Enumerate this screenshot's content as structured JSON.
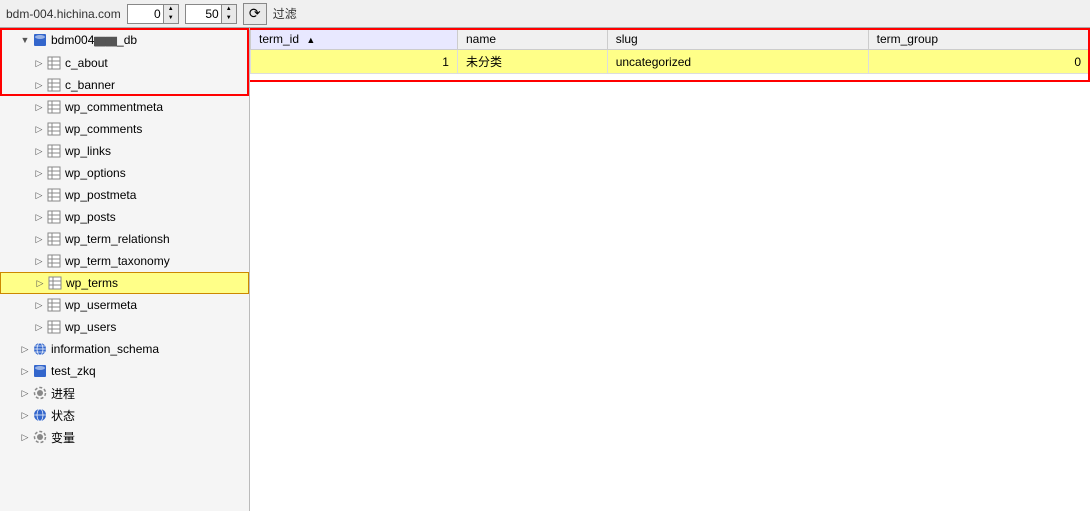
{
  "topbar": {
    "host": "bdm-004.hichina.com",
    "offset_value": "0",
    "limit_value": "50",
    "filter_label": "过滤",
    "refresh_icon": "↻"
  },
  "sidebar": {
    "databases": [
      {
        "name": "bdm004_db",
        "display": "bdm004███_db",
        "expanded": true,
        "tables": [
          {
            "name": "c_about",
            "selected": false
          },
          {
            "name": "c_banner",
            "selected": false
          },
          {
            "name": "wp_commentmeta",
            "selected": false
          },
          {
            "name": "wp_comments",
            "selected": false
          },
          {
            "name": "wp_links",
            "selected": false
          },
          {
            "name": "wp_options",
            "selected": false
          },
          {
            "name": "wp_postmeta",
            "selected": false
          },
          {
            "name": "wp_posts",
            "selected": false
          },
          {
            "name": "wp_term_relationsh",
            "selected": false
          },
          {
            "name": "wp_term_taxonomy",
            "selected": false
          },
          {
            "name": "wp_terms",
            "selected": true
          },
          {
            "name": "wp_usermeta",
            "selected": false
          },
          {
            "name": "wp_users",
            "selected": false
          }
        ]
      },
      {
        "name": "information_schema",
        "expanded": false,
        "type": "globe"
      },
      {
        "name": "test_zkq",
        "expanded": false,
        "type": "db"
      },
      {
        "name": "进程",
        "expanded": false,
        "type": "gear"
      },
      {
        "name": "状态",
        "expanded": false,
        "type": "globe"
      },
      {
        "name": "变量",
        "expanded": false,
        "type": "gear"
      }
    ]
  },
  "table": {
    "name": "wp_terms",
    "columns": [
      {
        "name": "term_id",
        "sorted": true,
        "sort_dir": "asc"
      },
      {
        "name": "name"
      },
      {
        "name": "slug"
      },
      {
        "name": "term_group"
      }
    ],
    "rows": [
      {
        "term_id": "1",
        "name": "未分类",
        "slug": "uncategorized",
        "term_group": "0"
      }
    ]
  }
}
